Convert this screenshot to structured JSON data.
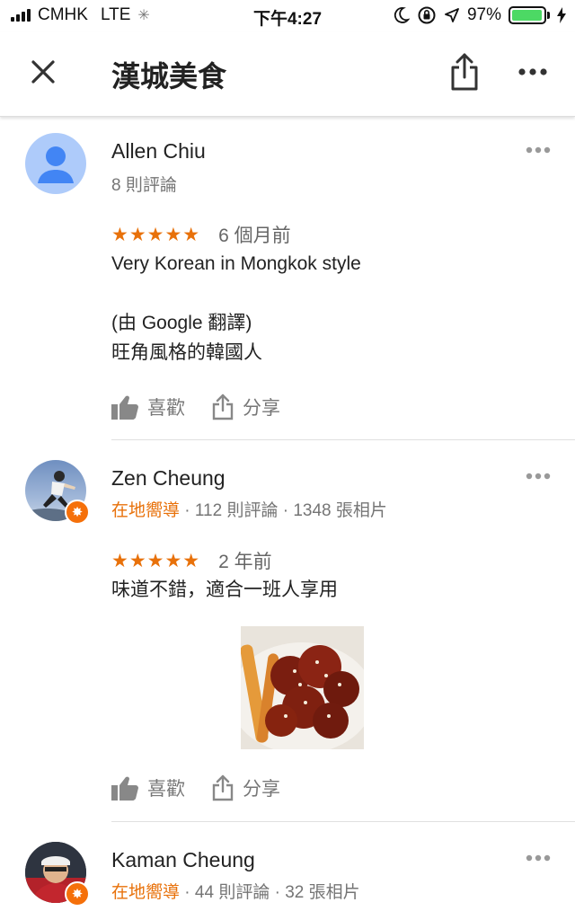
{
  "status_bar": {
    "carrier": "CMHK",
    "network": "LTE",
    "time": "下午4:27",
    "battery_percent": "97%",
    "battery_level": 0.97
  },
  "app_bar": {
    "title": "漢城美食"
  },
  "reviews": [
    {
      "name": "Allen Chiu",
      "meta": "8 則評論",
      "stars": "★★★★★",
      "date": "6 個月前",
      "text": "Very Korean in Mongkok style\n\n(由 Google 翻譯)\n旺角風格的韓國人",
      "like_label": "喜歡",
      "share_label": "分享"
    },
    {
      "name": "Zen Cheung",
      "guide": "在地嚮導",
      "meta": " · 112 則評論 · 1348 張相片",
      "stars": "★★★★★",
      "date": "2 年前",
      "text": "味道不錯，適合一班人享用",
      "like_label": "喜歡",
      "share_label": "分享"
    },
    {
      "name": "Kaman Cheung",
      "guide": "在地嚮導",
      "meta": " · 44 則評論 · 32 張相片"
    }
  ],
  "colors": {
    "accent_orange": "#e8710a",
    "avatar_blue": "#aecbfa",
    "avatar_figure": "#4285f4"
  }
}
